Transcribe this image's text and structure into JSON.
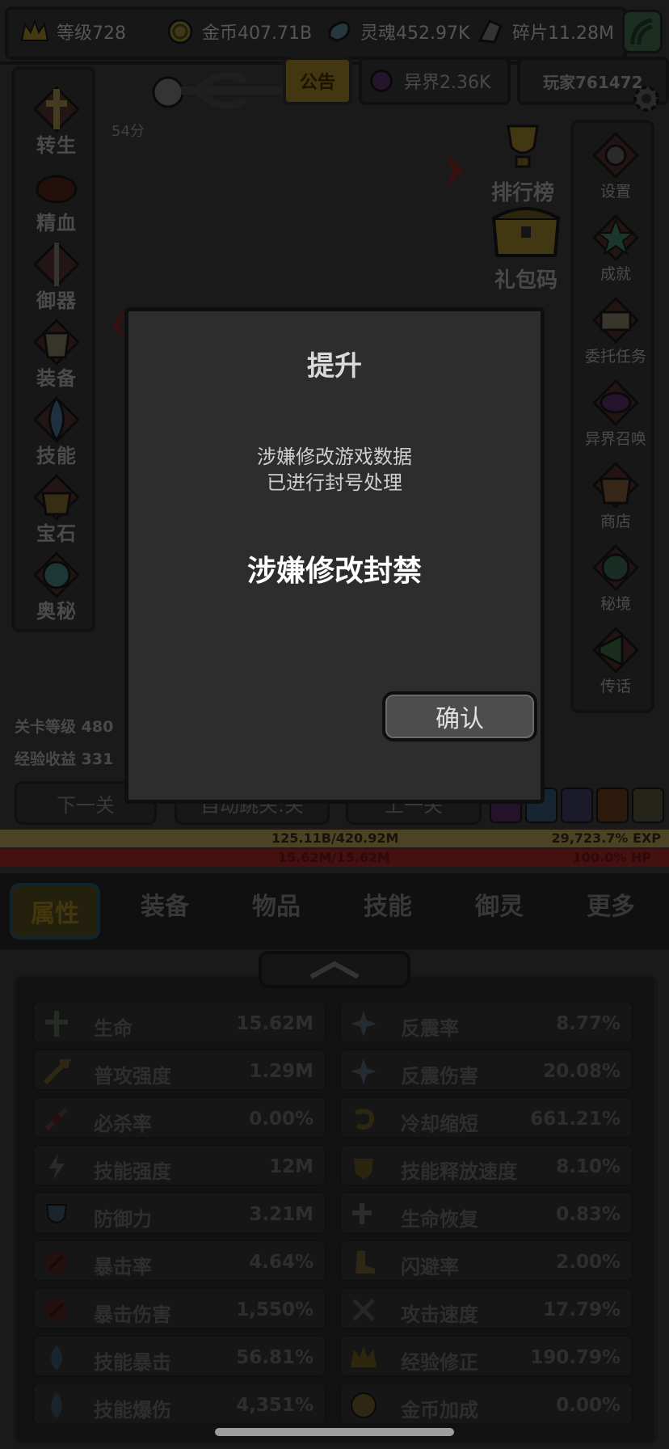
{
  "resources": {
    "level": "等级728",
    "gold": "金币407.71B",
    "soul": "灵魂452.97K",
    "shards": "碎片11.28M"
  },
  "tabs_top": {
    "notice": "公告",
    "otherworld": "异界2.36K",
    "player": "玩家761472"
  },
  "timer": "54分",
  "left_menu": [
    "转生",
    "精血",
    "御器",
    "装备",
    "技能",
    "宝石",
    "奥秘"
  ],
  "right_menu": [
    "设置",
    "成就",
    "委托任务",
    "异界召唤",
    "商店",
    "秘境",
    "传话"
  ],
  "mid": {
    "ranking": "排行榜",
    "giftcode": "礼包码"
  },
  "stage": {
    "level_label": "关卡等级",
    "level_value": "480",
    "exp_label": "经验收益",
    "exp_value": "331"
  },
  "stage_buttons": {
    "next": "下一关",
    "auto": "自动跳关:关",
    "prev": "上一关"
  },
  "bars": {
    "exp_text": "125.11B/420.92M",
    "exp_pct": "29,723.7% EXP",
    "hp_text": "15.62M/15.62M",
    "hp_pct": "100.0%   HP",
    "exp_fill": 1.0
  },
  "bottom_tabs": [
    "属性",
    "装备",
    "物品",
    "技能",
    "御灵",
    "更多"
  ],
  "attributes_left": [
    {
      "label": "生命",
      "value": "15.62M",
      "icon": "plus-sword-icon"
    },
    {
      "label": "普攻强度",
      "value": "1.29M",
      "icon": "arrow-icon"
    },
    {
      "label": "必杀率",
      "value": "0.00%",
      "icon": "crit-icon"
    },
    {
      "label": "技能强度",
      "value": "12M",
      "icon": "lightning-icon"
    },
    {
      "label": "防御力",
      "value": "3.21M",
      "icon": "shield-icon"
    },
    {
      "label": "暴击率",
      "value": "4.64%",
      "icon": "claw-icon"
    },
    {
      "label": "暴击伤害",
      "value": "1,550%",
      "icon": "claw-icon"
    },
    {
      "label": "技能暴击",
      "value": "56.81%",
      "icon": "flame-icon"
    },
    {
      "label": "技能爆伤",
      "value": "4,351%",
      "icon": "flame-icon"
    }
  ],
  "attributes_right": [
    {
      "label": "反震率",
      "value": "8.77%",
      "icon": "spark-icon"
    },
    {
      "label": "反震伤害",
      "value": "20.08%",
      "icon": "spark-icon"
    },
    {
      "label": "冷却缩短",
      "value": "661.21%",
      "icon": "swirl-icon"
    },
    {
      "label": "技能释放速度",
      "value": "8.10%",
      "icon": "crest-icon"
    },
    {
      "label": "生命恢复",
      "value": "0.83%",
      "icon": "heal-icon"
    },
    {
      "label": "闪避率",
      "value": "2.00%",
      "icon": "boot-icon"
    },
    {
      "label": "攻击速度",
      "value": "17.79%",
      "icon": "swords-icon"
    },
    {
      "label": "经验修正",
      "value": "190.79%",
      "icon": "crown-icon"
    },
    {
      "label": "金币加成",
      "value": "0.00%",
      "icon": "coin-icon"
    }
  ],
  "modal": {
    "title": "提升",
    "message_line1": "涉嫌修改游戏数据",
    "message_line2": "已进行封号处理",
    "ban_text": "涉嫌修改封禁",
    "confirm": "确认"
  }
}
